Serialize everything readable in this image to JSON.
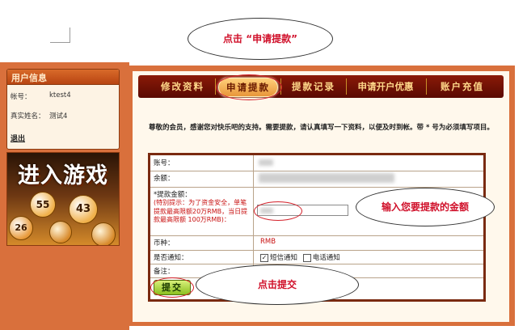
{
  "user_panel": {
    "title": "用户信息",
    "account_label": "帐号：",
    "account_value": "ktest4",
    "name_label": "真实姓名：",
    "name_value": "测试4",
    "logout": "退出"
  },
  "banner": {
    "title": "进入游戏",
    "balls": [
      "55",
      "43",
      "26"
    ]
  },
  "tabs": [
    {
      "label": "修改资料",
      "active": false
    },
    {
      "label": "申请提款",
      "active": true
    },
    {
      "label": "提款记录",
      "active": false
    },
    {
      "label": "申请开户优惠",
      "active": false
    },
    {
      "label": "账户充值",
      "active": false
    }
  ],
  "notice": "尊敬的会员，感谢您对快乐吧的支持。需要提款，请认真填写一下资料，以便及时到帐。带 * 号为必须填写项目。",
  "form": {
    "account_label": "账号：",
    "balance_label": "余额：",
    "amount_label": "*提款金额：",
    "amount_note": "(特别提示：为了资金安全，单笔提款最高限额20万RMB，当日提款最高限额 100万RMB)：",
    "currency_label": "币种：",
    "currency_value": "RMB",
    "notify_label": "是否通知：",
    "notify_options": [
      {
        "label": "短信通知",
        "checked": true
      },
      {
        "label": "电话通知",
        "checked": false
      }
    ],
    "remark_label": "备注：",
    "submit_label": "提交"
  },
  "annotations": {
    "click_apply": "点击 “申请提款”",
    "enter_amount": "输入您要提款的金额",
    "click_submit": "点击提交"
  },
  "colors": {
    "accent_orange": "#d9703c",
    "tab_bar": "#7a1206",
    "annotation_red": "#d0102a",
    "submit_green": "#8cc020"
  }
}
